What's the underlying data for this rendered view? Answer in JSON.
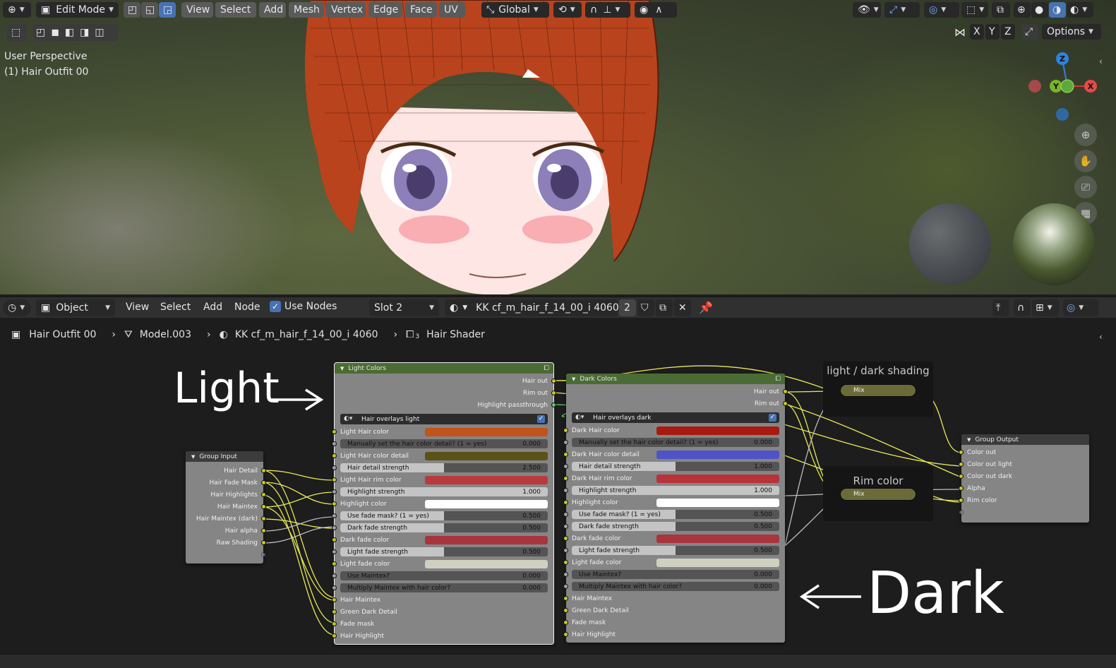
{
  "viewport": {
    "mode": "Edit Mode",
    "menus": [
      "View",
      "Select",
      "Add",
      "Mesh",
      "Vertex",
      "Edge",
      "Face",
      "UV"
    ],
    "orientation": "Global",
    "perspective_label": "User Perspective",
    "object_label": "(1) Hair Outfit 00",
    "axis_buttons": [
      "X",
      "Y",
      "Z"
    ],
    "options_label": "Options",
    "gizmo": {
      "z": "Z",
      "y": "Y",
      "x": "X"
    }
  },
  "node_header": {
    "editor_mode": "Object",
    "menus": [
      "View",
      "Select",
      "Add",
      "Node"
    ],
    "use_nodes_label": "Use Nodes",
    "slot": "Slot 2",
    "material_name": "KK cf_m_hair_f_14_00_i 4060",
    "users": "2"
  },
  "breadcrumbs": {
    "object": "Hair Outfit 00",
    "mesh": "Model.003",
    "material": "KK cf_m_hair_f_14_00_i 4060",
    "node_group": "Hair Shader",
    "node_group_sub": "3"
  },
  "annotations": {
    "light": "Light",
    "dark": "Dark"
  },
  "group_input": {
    "title": "Group Input",
    "outputs": [
      "Hair Detail",
      "Hair Fade Mask",
      "Hair Highlights",
      "Hair Maintex",
      "Hair Maintex (dark)",
      "Hair alpha",
      "Raw Shading"
    ]
  },
  "light_node": {
    "title": "Light Colors",
    "outputs": [
      "Hair out",
      "Rim out",
      "Highlight passthrough"
    ],
    "material": "Hair overlays light",
    "inputs": [
      {
        "type": "color",
        "label": "Light Hair color",
        "color": "#c0541c"
      },
      {
        "type": "value",
        "label": "Manually set the hair color detail? (1 = yes)",
        "value": "0.000",
        "fill": 0
      },
      {
        "type": "color",
        "label": "Light Hair color detail",
        "color": "#5a5218"
      },
      {
        "type": "value",
        "label": "Hair detail strength",
        "value": "2.500",
        "fill": 0.5
      },
      {
        "type": "color",
        "label": "Light Hair rim color",
        "color": "#b83a3e"
      },
      {
        "type": "value",
        "label": "Highlight strength",
        "value": "1.000",
        "fill": 1
      },
      {
        "type": "color",
        "label": "Highlight color",
        "color": "#ffffff"
      },
      {
        "type": "value",
        "label": "Use fade mask? (1 = yes)",
        "value": "0.500",
        "fill": 0.5
      },
      {
        "type": "value",
        "label": "Dark fade strength",
        "value": "0.500",
        "fill": 0.5
      },
      {
        "type": "color",
        "label": "Dark fade color",
        "color": "#a8343e"
      },
      {
        "type": "value",
        "label": "Light fade strength",
        "value": "0.500",
        "fill": 0.5
      },
      {
        "type": "color",
        "label": "Light fade color",
        "color": "#cfd0c0"
      },
      {
        "type": "value",
        "label": "Use Maintex?",
        "value": "0.000",
        "fill": 0
      },
      {
        "type": "value",
        "label": "Multiply Maintex with hair color?",
        "value": "0.000",
        "fill": 0
      },
      {
        "type": "socket",
        "label": "Hair Maintex"
      },
      {
        "type": "socket",
        "label": "Green Dark Detail"
      },
      {
        "type": "socket",
        "label": "Fade mask"
      },
      {
        "type": "socket",
        "label": "Hair Highlight"
      }
    ]
  },
  "dark_node": {
    "title": "Dark Colors",
    "outputs": [
      "Hair out",
      "Rim out"
    ],
    "material": "Hair overlays dark",
    "inputs": [
      {
        "type": "color",
        "label": "Dark Hair color",
        "color": "#a81a0e"
      },
      {
        "type": "value",
        "label": "Manually set the hair color detail? (1 = yes)",
        "value": "0.000",
        "fill": 0
      },
      {
        "type": "color",
        "label": "Dark Hair color detail",
        "color": "#5052c8"
      },
      {
        "type": "value",
        "label": "Hair detail strength",
        "value": "1.000",
        "fill": 0.5
      },
      {
        "type": "color",
        "label": "Dark Hair rim color",
        "color": "#b8323a"
      },
      {
        "type": "value",
        "label": "Highlight strength",
        "value": "1.000",
        "fill": 1
      },
      {
        "type": "color",
        "label": "Highlight color",
        "color": "#ffffff"
      },
      {
        "type": "value",
        "label": "Use fade mask? (1 = yes)",
        "value": "0.500",
        "fill": 0.5
      },
      {
        "type": "value",
        "label": "Dark fade strength",
        "value": "0.500",
        "fill": 0.5
      },
      {
        "type": "color",
        "label": "Dark fade color",
        "color": "#a8343e"
      },
      {
        "type": "value",
        "label": "Light fade strength",
        "value": "0.500",
        "fill": 0.5
      },
      {
        "type": "color",
        "label": "Light fade color",
        "color": "#cfd0c0"
      },
      {
        "type": "value",
        "label": "Use Maintex?",
        "value": "0.000",
        "fill": 0
      },
      {
        "type": "value",
        "label": "Multiply Maintex with hair color?",
        "value": "0.000",
        "fill": 0
      },
      {
        "type": "socket",
        "label": "Hair Maintex"
      },
      {
        "type": "socket",
        "label": "Green Dark Detail"
      },
      {
        "type": "socket",
        "label": "Fade mask"
      },
      {
        "type": "socket",
        "label": "Hair Highlight"
      }
    ]
  },
  "frames": [
    {
      "title": "light / dark shading",
      "mix_label": "Mix"
    },
    {
      "title": "Rim color",
      "mix_label": "Mix"
    }
  ],
  "group_output": {
    "title": "Group Output",
    "inputs": [
      "Color out",
      "Color out light",
      "Color out dark",
      "Alpha",
      "Rim color"
    ]
  }
}
